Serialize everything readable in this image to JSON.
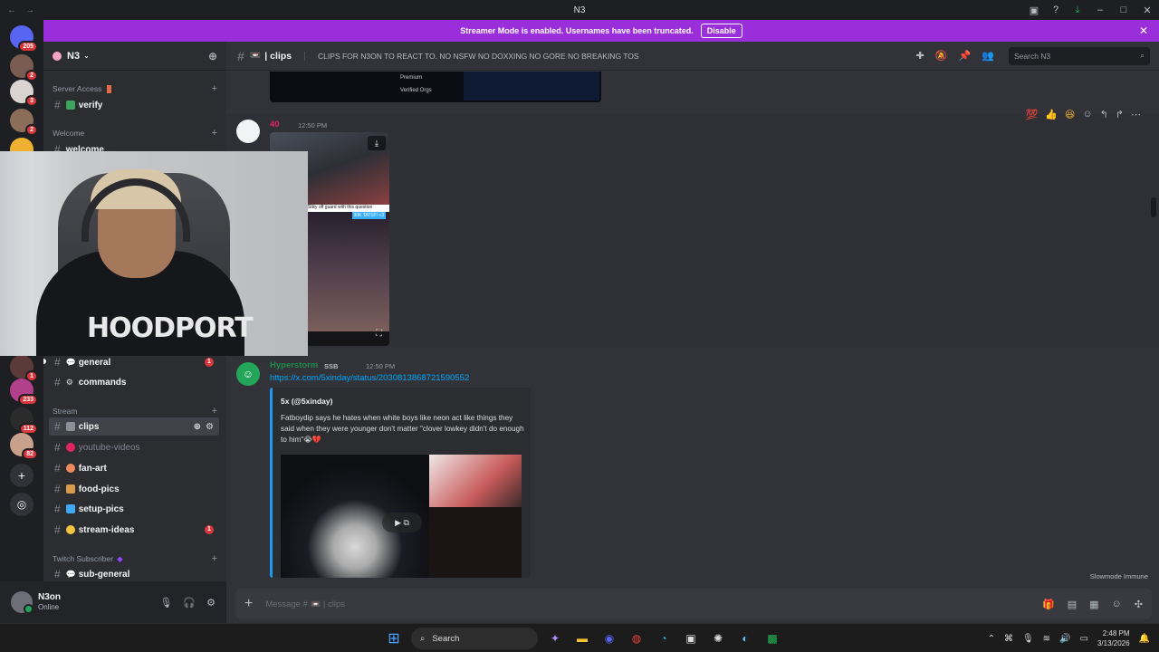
{
  "window": {
    "title": "N3",
    "back": "←",
    "forward": "→"
  },
  "banner": {
    "text": "Streamer Mode is enabled. Usernames have been truncated.",
    "button": "Disable",
    "close": "✕"
  },
  "servers": [
    {
      "badge": "205",
      "color": "#5865f2"
    },
    {
      "badge": "2",
      "color": "#7a5c52"
    },
    {
      "badge": "3",
      "color": "#d9d4cf"
    },
    {
      "badge": "2",
      "color": "#8c6d5a"
    },
    {
      "badge": "",
      "color": "#f0b132"
    }
  ],
  "servers_lower": [
    {
      "badge": "1",
      "color": "#5d3a3a"
    },
    {
      "badge": "233",
      "color": "#b3408a"
    },
    {
      "badge": "112",
      "color": "#2b2b2b"
    },
    {
      "badge": "82",
      "color": "#c9a08a"
    }
  ],
  "sidebar": {
    "guild_name": "N3",
    "categories": {
      "server_access": "Server Access",
      "welcome": "Welcome",
      "stream": "Stream",
      "twitch_sub": "Twitch Subscriber"
    },
    "channels": {
      "verify": "verify",
      "welcome": "welcome",
      "general": "general",
      "commands": "commands",
      "clips": "clips",
      "youtube": "youtube-videos",
      "fanart": "fan-art",
      "food": "food-pics",
      "setup": "setup-pics",
      "ideas": "stream-ideas",
      "subgeneral": "sub-general"
    },
    "badges": {
      "general": "1",
      "ideas": "1"
    }
  },
  "user": {
    "name": "N3on",
    "status": "Online"
  },
  "header": {
    "channel": "| clips",
    "topic": "CLIPS FOR N3ON TO REACT TO. NO NSFW NO DOXXING NO GORE NO BREAKING TOS",
    "search_placeholder": "Search N3"
  },
  "top_image": {
    "line1": "Premium",
    "line2": "Verified Orgs"
  },
  "messages": [
    {
      "author": "40",
      "time": "12:50 PM",
      "caption": "Sliky off guard with this question",
      "tag": "30K TATS!!! +3"
    },
    {
      "author": "Hyperstorm",
      "tag": "SSB",
      "time": "12:50 PM",
      "link": "https://x.com/5xinday/status/2030813868721590552",
      "embed": {
        "author": "5x (@5xinday)",
        "text": "Fatboydip says he hates when white boys like neon act like things they said when they were younger don't matter \"clover lowkey didn't do enough to him\"😭💔"
      }
    }
  ],
  "slowmode": "Slowmode Immune",
  "composer": {
    "placeholder": "Message # 📼 | clips"
  },
  "taskbar": {
    "search": "Search",
    "time": "2:48 PM",
    "date": "3/13/2026"
  }
}
